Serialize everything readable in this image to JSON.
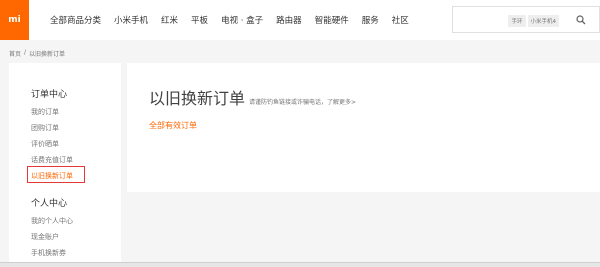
{
  "header": {
    "logo_text": "mi",
    "nav": [
      "全部商品分类",
      "小米手机",
      "红米",
      "平板",
      "电视 · 盒子",
      "路由器",
      "智能硬件",
      "服务",
      "社区"
    ],
    "search": {
      "placeholder": "",
      "tags": [
        "手环",
        "小米手机4"
      ]
    }
  },
  "breadcrumb": {
    "home": "首页",
    "separator": "/",
    "current": "以旧换新订单"
  },
  "sidebar": {
    "order_center": {
      "title": "订单中心",
      "items": [
        "我的订单",
        "团购订单",
        "评价晒单",
        "话费充值订单",
        "以旧换新订单"
      ]
    },
    "personal_center": {
      "title": "个人中心",
      "items": [
        "我的个人中心",
        "现金账户",
        "手机换新券"
      ]
    }
  },
  "main": {
    "title": "以旧换新订单",
    "notice": "请谨防钓鱼链接或诈骗电话，了解更多>",
    "tab_all": "全部有效订单"
  },
  "colors": {
    "accent": "#ff6700",
    "highlight_box": "#e53935"
  }
}
